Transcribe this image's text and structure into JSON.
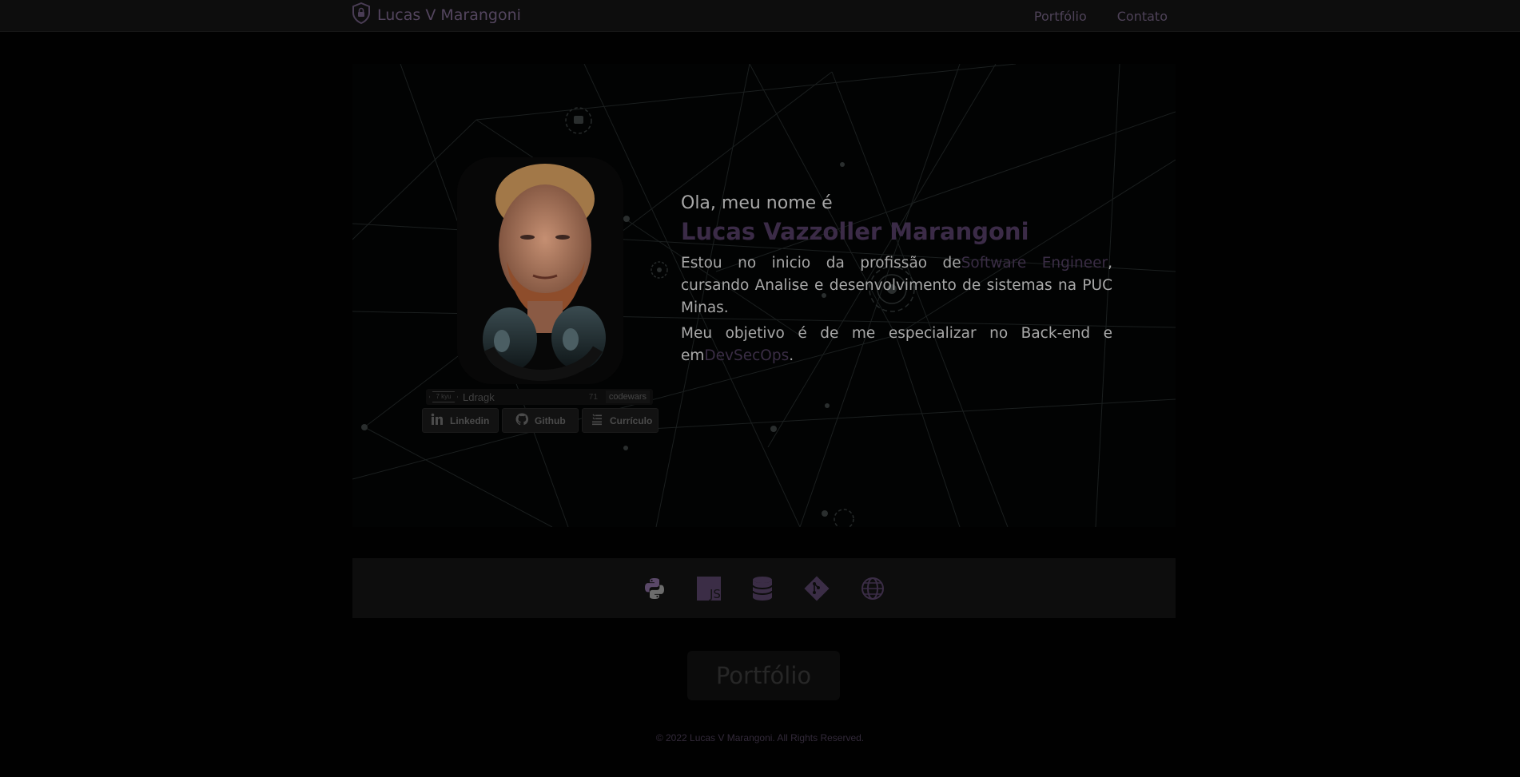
{
  "header": {
    "brand_icon": "shield-lock-icon",
    "brand_name": "Lucas V Marangoni",
    "nav": [
      {
        "label": "Portfólio"
      },
      {
        "label": "Contato"
      }
    ]
  },
  "profile": {
    "greeting": "Ola, meu nome é",
    "full_name": "Lucas Vazzoller Marangoni",
    "bio_1_before": "Estou no inicio da profissão de",
    "bio_1_highlight": "Software Engineer",
    "bio_1_after": ", cursando Analise e desenvolvimento de sistemas na PUC Minas.",
    "bio_2_before": "Meu objetivo é de me especializar no Back-end e em",
    "bio_2_highlight": "DevSecOps",
    "bio_2_after": "."
  },
  "codewars": {
    "rank": "7 kyu",
    "username": "Ldragk",
    "score": "71",
    "site": "codewars"
  },
  "social": [
    {
      "label": "Linkedin",
      "icon": "linkedin-icon"
    },
    {
      "label": "Github",
      "icon": "github-icon"
    },
    {
      "label": "Currículo",
      "icon": "document-list-icon"
    }
  ],
  "skills": [
    "python-icon",
    "javascript-icon",
    "database-icon",
    "git-icon",
    "web-globe-icon"
  ],
  "portfolio_button": "Portfólio",
  "footer": "© 2022 Lucas V Marangoni. All Rights Reserved.",
  "colors": {
    "accent": "#3b2b47",
    "background": "#010101",
    "header": "#0d0d0d"
  }
}
